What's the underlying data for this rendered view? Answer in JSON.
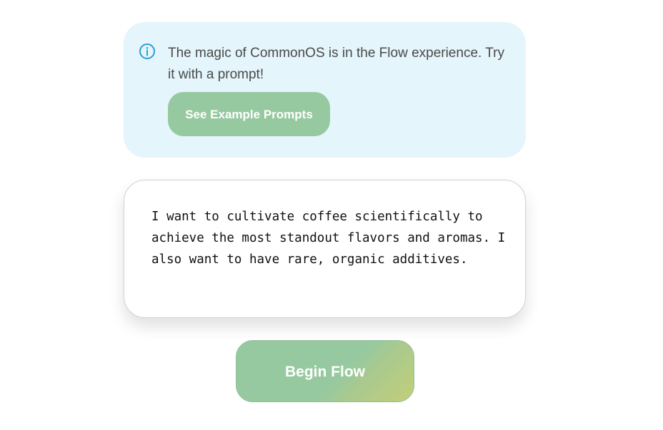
{
  "info": {
    "icon": "info-icon",
    "message": "The magic of CommonOS is in the Flow experience. Try it with a prompt!",
    "example_button_label": "See Example Prompts"
  },
  "prompt": {
    "text": "I want to cultivate coffee scientifically to achieve the most standout flavors and aromas. I also want to have rare, organic additives."
  },
  "begin_button_label": "Begin Flow",
  "colors": {
    "info_background": "#e4f5fb",
    "accent_green": "#97c9a0",
    "gradient_end": "#c2cf78",
    "info_icon": "#2a9fd8",
    "text": "#4a4a4a"
  }
}
